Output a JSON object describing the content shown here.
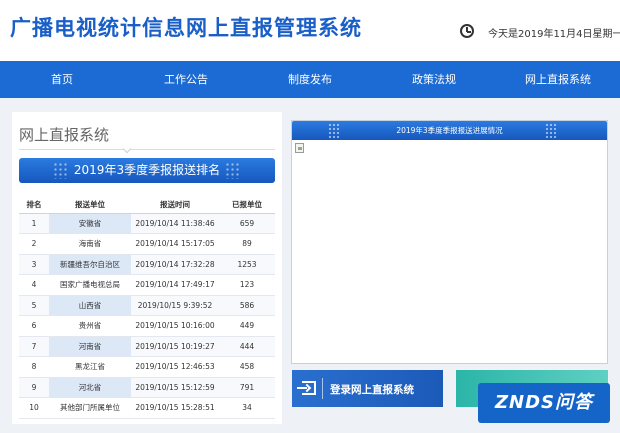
{
  "header": {
    "title": "广播电视统计信息网上直报管理系统",
    "date": "今天是2019年11月4日星期一"
  },
  "nav": {
    "items": [
      "首页",
      "工作公告",
      "制度发布",
      "政策法规",
      "网上直报系统"
    ]
  },
  "left": {
    "section_title": "网上直报系统",
    "banner": "2019年3季度季报报送排名",
    "columns": [
      "排名",
      "报送单位",
      "报送时间",
      "已报单位"
    ],
    "rows": [
      [
        "1",
        "安徽省",
        "2019/10/14 11:38:46",
        "659"
      ],
      [
        "2",
        "海南省",
        "2019/10/14 15:17:05",
        "89"
      ],
      [
        "3",
        "新疆维吾尔自治区",
        "2019/10/14 17:32:28",
        "1253"
      ],
      [
        "4",
        "国家广播电视总局",
        "2019/10/14 17:49:17",
        "123"
      ],
      [
        "5",
        "山西省",
        "2019/10/15 9:39:52",
        "586"
      ],
      [
        "6",
        "贵州省",
        "2019/10/15 10:16:00",
        "449"
      ],
      [
        "7",
        "河南省",
        "2019/10/15 10:19:27",
        "444"
      ],
      [
        "8",
        "黑龙江省",
        "2019/10/15 12:46:53",
        "458"
      ],
      [
        "9",
        "河北省",
        "2019/10/15 15:12:59",
        "791"
      ],
      [
        "10",
        "其他部门所属单位",
        "2019/10/15 15:28:51",
        "34"
      ]
    ]
  },
  "right": {
    "panel_title": "2019年3季度季报报送进展情况"
  },
  "login": {
    "label": "登录网上直报系统"
  },
  "watermark": "ZNDS问答",
  "colors": {
    "primary": "#1c6bd4",
    "title": "#1a5fc8",
    "teal": "#2bb5a8"
  }
}
